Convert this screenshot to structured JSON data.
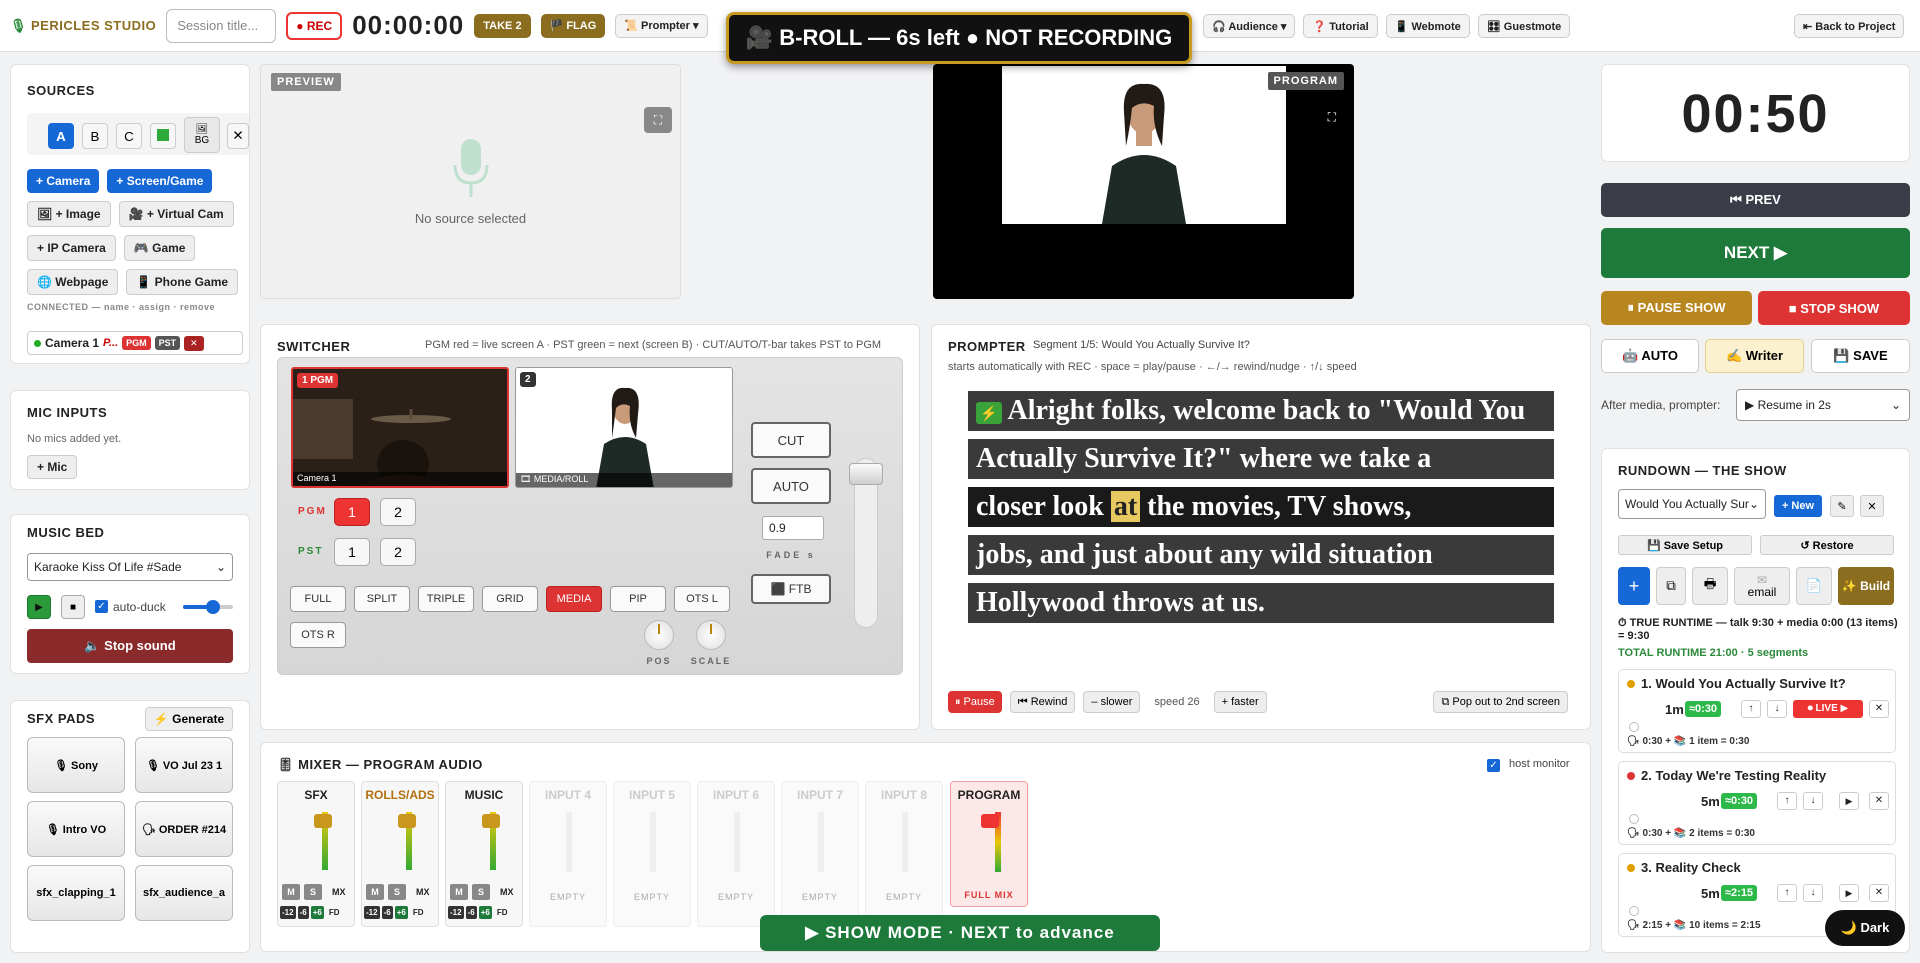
{
  "top": {
    "brand": "PERICLES STUDIO",
    "session_placeholder": "Session title...",
    "rec": "● REC",
    "timer": "00:00:00",
    "take": "TAKE 2",
    "flag": "🏴 FLAG",
    "prompter": "📜 Prompter ▾",
    "audience": "🎧 Audience ▾",
    "tutorial": "❓ Tutorial",
    "webmote": "📱 Webmote",
    "guestmote": "🎛 Guestmote",
    "back": "⇤ Back to Project"
  },
  "banner": "🎥 B-ROLL — 6s left ● NOT RECORDING",
  "sources": {
    "title": "SOURCES",
    "scenes": [
      "A",
      "B",
      "C"
    ],
    "green": "",
    "bg": "BG",
    "close": "✕",
    "add": [
      "+ Camera",
      "+ Screen/Game",
      "🖼 + Image",
      "🎥 + Virtual Cam",
      "+ IP Camera",
      "🎮 Game",
      "🌐 Webpage",
      "📱 Phone Game"
    ],
    "connected_label": "CONNECTED — name · assign · remove",
    "device": {
      "name": "Camera 1",
      "tag": "P...",
      "pgm": "PGM",
      "pst": "PST",
      "del": "✕"
    }
  },
  "mics": {
    "title": "MIC INPUTS",
    "empty": "No mics added yet.",
    "add": "+ Mic"
  },
  "music": {
    "title": "MUSIC BED",
    "track": "Karaoke Kiss Of Life #Sade",
    "play": "▶",
    "stop": "■",
    "autoduck": "auto-duck",
    "volume": 0.6,
    "stop_sound": "🔈 Stop sound"
  },
  "sfx": {
    "title": "SFX PADS",
    "generate": "⚡ Generate",
    "pads": [
      "🎙 Sony",
      "🎙 VO Jul 23 1",
      "🎙 Intro VO",
      "🗣 ORDER #214",
      "sfx_clapping_1",
      "sfx_audience_a"
    ]
  },
  "preview": {
    "label": "PREVIEW",
    "empty": "No source selected"
  },
  "program": {
    "label": "PROGRAM"
  },
  "switcher": {
    "title": "SWITCHER",
    "hint": "PGM red = live screen A · PST green = next (screen B) · CUT/AUTO/T-bar takes PST to PGM",
    "tile1_badge": "1 PGM",
    "tile1_cap": "Camera 1",
    "tile2_badge": "2",
    "tile2_cap": "🎞 MEDIA/ROLL",
    "pgm_label": "PGM",
    "pst_label": "PST",
    "b1": "1",
    "b2": "2",
    "layouts": [
      "FULL",
      "SPLIT",
      "TRIPLE",
      "GRID",
      "MEDIA",
      "PIP",
      "OTS L",
      "OTS R"
    ],
    "cut": "CUT",
    "auto": "AUTO",
    "fade": "0.9",
    "fade_label": "FADE s",
    "ftb": "⬛ FTB",
    "pos": "POS",
    "scale": "SCALE"
  },
  "prompter": {
    "title": "PROMPTER",
    "segment": "Segment 1/5: Would You Actually Survive It?",
    "hint": "starts automatically with REC · space = play/pause · ←/→ rewind/nudge · ↑/↓ speed",
    "lines": [
      "Alright folks, welcome back to \"Would You",
      "Actually Survive It?\" where we take a",
      "closer look",
      "the movies, TV shows,",
      "jobs, and just about any wild situation",
      "Hollywood throws at us."
    ],
    "highlight": "at",
    "bolt": "⚡",
    "pause": "⏸ Pause",
    "rewind": "⏮ Rewind",
    "slower": "– slower",
    "speed": "speed 26",
    "faster": "+ faster",
    "popout": "⧉ Pop out to 2nd screen"
  },
  "mixer": {
    "title": "🎚 MIXER — PROGRAM AUDIO",
    "host_monitor": "host monitor",
    "channels": [
      {
        "name": "SFX",
        "active": true,
        "color": "#222"
      },
      {
        "name": "ROLLS/ADS",
        "active": true,
        "color": "#b07010"
      },
      {
        "name": "MUSIC",
        "active": true,
        "color": "#222"
      },
      {
        "name": "INPUT 4",
        "active": false
      },
      {
        "name": "INPUT 5",
        "active": false
      },
      {
        "name": "INPUT 6",
        "active": false
      },
      {
        "name": "INPUT 7",
        "active": false
      },
      {
        "name": "INPUT 8",
        "active": false
      }
    ],
    "m": "M",
    "s": "S",
    "mx": "MX",
    "empty": "EMPTY",
    "db": [
      "-12",
      "-6",
      "+6"
    ],
    "fd": "FD",
    "program": "PROGRAM",
    "full_mix": "FULL MIX"
  },
  "show_mode": "▶ SHOW MODE · NEXT to advance",
  "right": {
    "clock": "00:50",
    "prev": "⏮ PREV",
    "next": "NEXT ▶",
    "pause": "⏸ PAUSE SHOW",
    "stop": "■ STOP SHOW",
    "auto": "🤖 AUTO",
    "writer": "✍ Writer",
    "save": "💾 SAVE",
    "after_media_label": "After media, prompter:",
    "after_media": "▶ Resume in 2s"
  },
  "rundown": {
    "title": "RUNDOWN — THE SHOW",
    "show": "Would You Actually Sur",
    "new": "+ New",
    "edit": "✎",
    "del": "✕",
    "save_setup": "💾 Save Setup",
    "restore": "↺ Restore",
    "plus": "+",
    "copy": "⧉",
    "print": "🖶",
    "email": "email",
    "doc": "📄",
    "build": "✨ Build",
    "runtime": "⏱ TRUE RUNTIME — talk 9:30 + media 0:00 (13 items) = 9:30",
    "total": "TOTAL RUNTIME 21:00 · 5 segments",
    "segments": [
      {
        "title": "1. Would You Actually Survive It?",
        "dur": "1m",
        "est": "≈0:30",
        "live": "⏺ LIVE ▶",
        "detail": "🗣 0:30 + 📚 1 item = 0:30",
        "dot": "#e0a000"
      },
      {
        "title": "2. Today We're Testing Reality",
        "dur": "5m",
        "est": "≈0:30",
        "detail": "🗣 0:30 + 📚 2 items = 0:30",
        "dot": "#d33"
      },
      {
        "title": "3. Reality Check",
        "dur": "5m",
        "est": "≈2:15",
        "detail": "🗣 2:15 + 📚 10 items = 2:15",
        "dot": "#e0a000"
      }
    ]
  },
  "dark": "🌙 Dark"
}
